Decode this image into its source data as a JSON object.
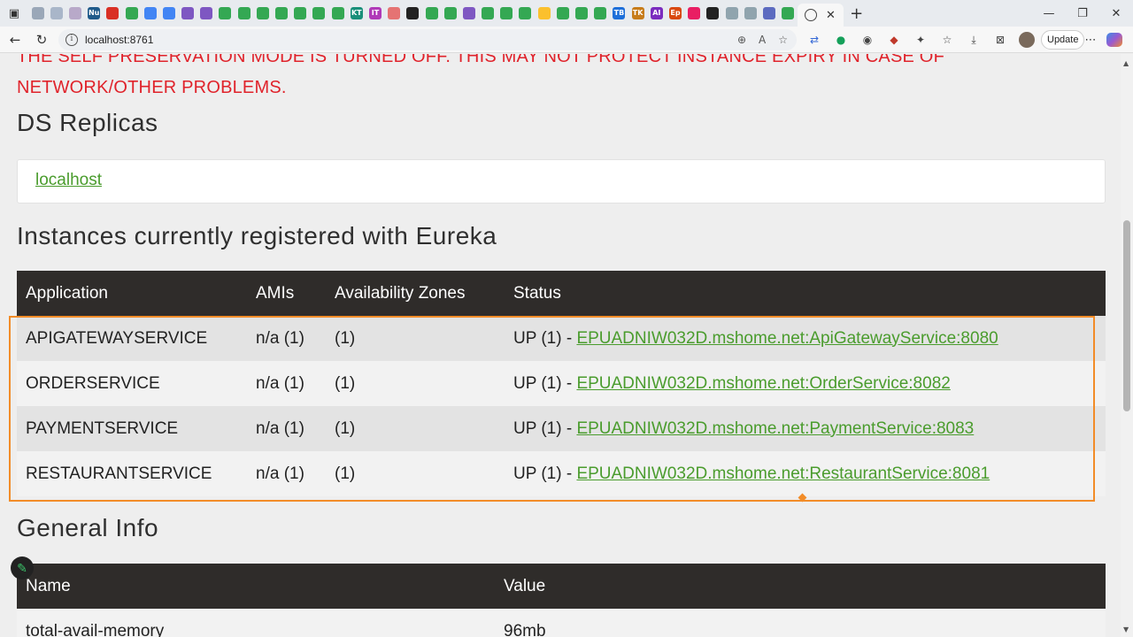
{
  "browser": {
    "url": "localhost:8761",
    "update_label": "Update",
    "tab_badges": [
      {
        "label": "",
        "color": "#9aa7b8"
      },
      {
        "label": "",
        "color": "#a9b6c9"
      },
      {
        "label": "",
        "color": "#b8a9c9"
      },
      {
        "label": "Nu",
        "color": "#1f5a8a"
      },
      {
        "label": "",
        "color": "#d93025"
      },
      {
        "label": "",
        "color": "#34a853"
      },
      {
        "label": "",
        "color": "#4285f4"
      },
      {
        "label": "",
        "color": "#4285f4"
      },
      {
        "label": "",
        "color": "#7e57c2"
      },
      {
        "label": "",
        "color": "#7e57c2"
      },
      {
        "label": "",
        "color": "#34a853"
      },
      {
        "label": "",
        "color": "#34a853"
      },
      {
        "label": "",
        "color": "#34a853"
      },
      {
        "label": "",
        "color": "#34a853"
      },
      {
        "label": "",
        "color": "#34a853"
      },
      {
        "label": "",
        "color": "#34a853"
      },
      {
        "label": "",
        "color": "#34a853"
      },
      {
        "label": "KT",
        "color": "#1a8f7a"
      },
      {
        "label": "IT",
        "color": "#b03ab8"
      },
      {
        "label": "",
        "color": "#e57373"
      },
      {
        "label": "",
        "color": "#222222"
      },
      {
        "label": "",
        "color": "#34a853"
      },
      {
        "label": "",
        "color": "#34a853"
      },
      {
        "label": "",
        "color": "#7e57c2"
      },
      {
        "label": "",
        "color": "#34a853"
      },
      {
        "label": "",
        "color": "#34a853"
      },
      {
        "label": "",
        "color": "#34a853"
      },
      {
        "label": "",
        "color": "#fbc02d"
      },
      {
        "label": "",
        "color": "#34a853"
      },
      {
        "label": "",
        "color": "#34a853"
      },
      {
        "label": "",
        "color": "#34a853"
      },
      {
        "label": "TB",
        "color": "#1e6fd9"
      },
      {
        "label": "TK",
        "color": "#c77c1a"
      },
      {
        "label": "AI",
        "color": "#7b2cbf"
      },
      {
        "label": "Ep",
        "color": "#d9480f"
      },
      {
        "label": "",
        "color": "#e91e63"
      },
      {
        "label": "",
        "color": "#222222"
      },
      {
        "label": "",
        "color": "#90a4ae"
      },
      {
        "label": "",
        "color": "#90a4ae"
      },
      {
        "label": "",
        "color": "#5c6bc0"
      },
      {
        "label": "",
        "color": "#34a853"
      }
    ]
  },
  "page": {
    "warning": "THE SELF PRESERVATION MODE IS TURNED OFF. THIS MAY NOT PROTECT INSTANCE EXPIRY IN CASE OF NETWORK/OTHER PROBLEMS.",
    "ds_replicas_title": "DS Replicas",
    "replica_link": "localhost",
    "instances_title": "Instances currently registered with Eureka",
    "instances_headers": [
      "Application",
      "AMIs",
      "Availability Zones",
      "Status"
    ],
    "instances": [
      {
        "app": "APIGATEWAYSERVICE",
        "amis": "n/a (1)",
        "zones": "(1)",
        "status_prefix": "UP (1) - ",
        "status_link": "EPUADNIW032D.mshome.net:ApiGatewayService:8080"
      },
      {
        "app": "ORDERSERVICE",
        "amis": "n/a (1)",
        "zones": "(1)",
        "status_prefix": "UP (1) - ",
        "status_link": "EPUADNIW032D.mshome.net:OrderService:8082"
      },
      {
        "app": "PAYMENTSERVICE",
        "amis": "n/a (1)",
        "zones": "(1)",
        "status_prefix": "UP (1) - ",
        "status_link": "EPUADNIW032D.mshome.net:PaymentService:8083"
      },
      {
        "app": "RESTAURANTSERVICE",
        "amis": "n/a (1)",
        "zones": "(1)",
        "status_prefix": "UP (1) - ",
        "status_link": "EPUADNIW032D.mshome.net:RestaurantService:8081"
      }
    ],
    "general_info_title": "General Info",
    "general_headers": [
      "Name",
      "Value"
    ],
    "general_rows": [
      {
        "name": "total-avail-memory",
        "value": "96mb"
      }
    ]
  },
  "colors": {
    "warning": "#e0232b",
    "link": "#4a9c2d",
    "table_header": "#2f2c2a",
    "highlight": "#f28c28"
  }
}
